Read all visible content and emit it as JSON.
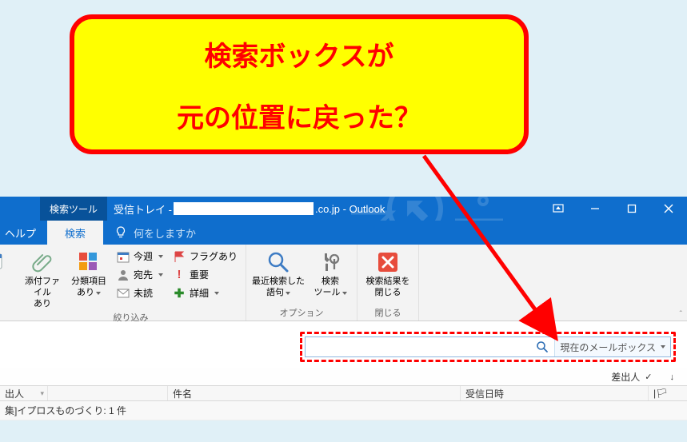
{
  "callout": {
    "line1": "検索ボックスが",
    "line2": "元の位置に戻った？"
  },
  "titlebar": {
    "tools_tab": "検索ツール",
    "prefix": "受信トレイ - ",
    "suffix": ".co.jp  -  Outlook"
  },
  "tabs": {
    "help": "ヘルプ",
    "search": "検索",
    "tell_me": "何をしますか"
  },
  "ribbon": {
    "refine": {
      "label": "絞り込み",
      "attachments_line1": "添付ファイル",
      "attachments_line2": "あり",
      "categories_line1": "分類項目",
      "categories_line2": "あり",
      "this_week": "今週",
      "to": "宛先",
      "unread": "未読",
      "flagged": "フラグあり",
      "important": "重要",
      "more": "詳細"
    },
    "options": {
      "label": "オプション",
      "recent_line1": "最近検索した",
      "recent_line2": "語句",
      "tools_line1": "検索",
      "tools_line2": "ツール"
    },
    "close": {
      "label": "閉じる",
      "close_line1": "検索結果を",
      "close_line2": "閉じる"
    }
  },
  "search": {
    "scope": "現在のメールボックス"
  },
  "sort": {
    "by": "差出人",
    "dir_glyph": "✓",
    "arrow_glyph": "↓"
  },
  "columns": {
    "from": "出人",
    "subject": "件名",
    "received": "受信日時",
    "flag": "|🏳"
  },
  "group": {
    "text": "集]イプロスものづくり: 1 件"
  }
}
